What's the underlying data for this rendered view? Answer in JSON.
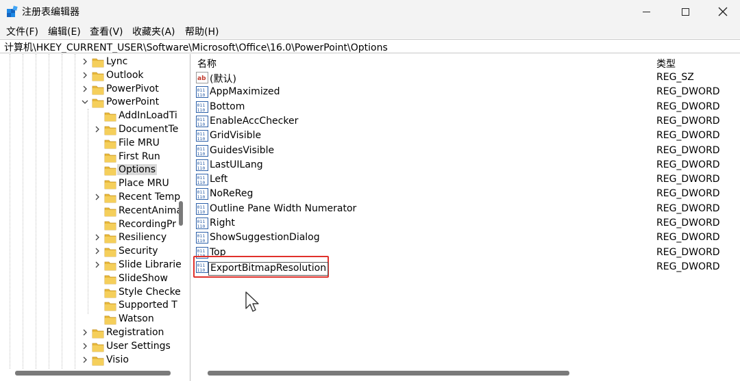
{
  "window": {
    "title": "注册表编辑器"
  },
  "menu": [
    {
      "label": "文件(F)"
    },
    {
      "label": "编辑(E)"
    },
    {
      "label": "查看(V)"
    },
    {
      "label": "收藏夹(A)"
    },
    {
      "label": "帮助(H)"
    }
  ],
  "address": {
    "path": "计算机\\HKEY_CURRENT_USER\\Software\\Microsoft\\Office\\16.0\\PowerPoint\\Options"
  },
  "tree": {
    "items": [
      {
        "label": "Lync",
        "expandable": true,
        "expanded": false,
        "level": 1
      },
      {
        "label": "Outlook",
        "expandable": true,
        "expanded": false,
        "level": 1
      },
      {
        "label": "PowerPivot",
        "expandable": true,
        "expanded": false,
        "level": 1
      },
      {
        "label": "PowerPoint",
        "expandable": true,
        "expanded": true,
        "level": 1
      },
      {
        "label": "AddInLoadTi",
        "expandable": false,
        "expanded": false,
        "level": 2
      },
      {
        "label": "DocumentTe",
        "expandable": true,
        "expanded": false,
        "level": 2
      },
      {
        "label": "File MRU",
        "expandable": false,
        "expanded": false,
        "level": 2
      },
      {
        "label": "First Run",
        "expandable": false,
        "expanded": false,
        "level": 2
      },
      {
        "label": "Options",
        "expandable": false,
        "expanded": false,
        "level": 2,
        "selected": true
      },
      {
        "label": "Place MRU",
        "expandable": false,
        "expanded": false,
        "level": 2
      },
      {
        "label": "Recent Temp",
        "expandable": true,
        "expanded": false,
        "level": 2
      },
      {
        "label": "RecentAnima",
        "expandable": false,
        "expanded": false,
        "level": 2
      },
      {
        "label": "RecordingPr",
        "expandable": false,
        "expanded": false,
        "level": 2
      },
      {
        "label": "Resiliency",
        "expandable": true,
        "expanded": false,
        "level": 2
      },
      {
        "label": "Security",
        "expandable": true,
        "expanded": false,
        "level": 2
      },
      {
        "label": "Slide Librarie",
        "expandable": true,
        "expanded": false,
        "level": 2
      },
      {
        "label": "SlideShow",
        "expandable": false,
        "expanded": false,
        "level": 2
      },
      {
        "label": "Style Checke",
        "expandable": false,
        "expanded": false,
        "level": 2
      },
      {
        "label": "Supported T",
        "expandable": false,
        "expanded": false,
        "level": 2
      },
      {
        "label": "Watson",
        "expandable": false,
        "expanded": false,
        "level": 2
      },
      {
        "label": "Registration",
        "expandable": true,
        "expanded": false,
        "level": 1
      },
      {
        "label": "User Settings",
        "expandable": true,
        "expanded": false,
        "level": 1
      },
      {
        "label": "Visio",
        "expandable": true,
        "expanded": false,
        "level": 1
      }
    ]
  },
  "list": {
    "columns": {
      "name": "名称",
      "type": "类型"
    },
    "rows": [
      {
        "name": "(默认)",
        "type": "REG_SZ",
        "icon": "string-value-icon"
      },
      {
        "name": "AppMaximized",
        "type": "REG_DWORD",
        "icon": "binary-value-icon"
      },
      {
        "name": "Bottom",
        "type": "REG_DWORD",
        "icon": "binary-value-icon"
      },
      {
        "name": "EnableAccChecker",
        "type": "REG_DWORD",
        "icon": "binary-value-icon"
      },
      {
        "name": "GridVisible",
        "type": "REG_DWORD",
        "icon": "binary-value-icon"
      },
      {
        "name": "GuidesVisible",
        "type": "REG_DWORD",
        "icon": "binary-value-icon"
      },
      {
        "name": "LastUILang",
        "type": "REG_DWORD",
        "icon": "binary-value-icon"
      },
      {
        "name": "Left",
        "type": "REG_DWORD",
        "icon": "binary-value-icon"
      },
      {
        "name": "NoReReg",
        "type": "REG_DWORD",
        "icon": "binary-value-icon"
      },
      {
        "name": "Outline Pane Width Numerator",
        "type": "REG_DWORD",
        "icon": "binary-value-icon"
      },
      {
        "name": "Right",
        "type": "REG_DWORD",
        "icon": "binary-value-icon"
      },
      {
        "name": "ShowSuggestionDialog",
        "type": "REG_DWORD",
        "icon": "binary-value-icon"
      },
      {
        "name": "Top",
        "type": "REG_DWORD",
        "icon": "binary-value-icon"
      },
      {
        "name": "ExportBitmapResolution",
        "type": "REG_DWORD",
        "icon": "binary-value-icon",
        "editing": true
      }
    ]
  },
  "colors": {
    "highlight_border": "#e0302a",
    "folder": "#e8b93a",
    "value_icon": "#2b5fa8"
  }
}
